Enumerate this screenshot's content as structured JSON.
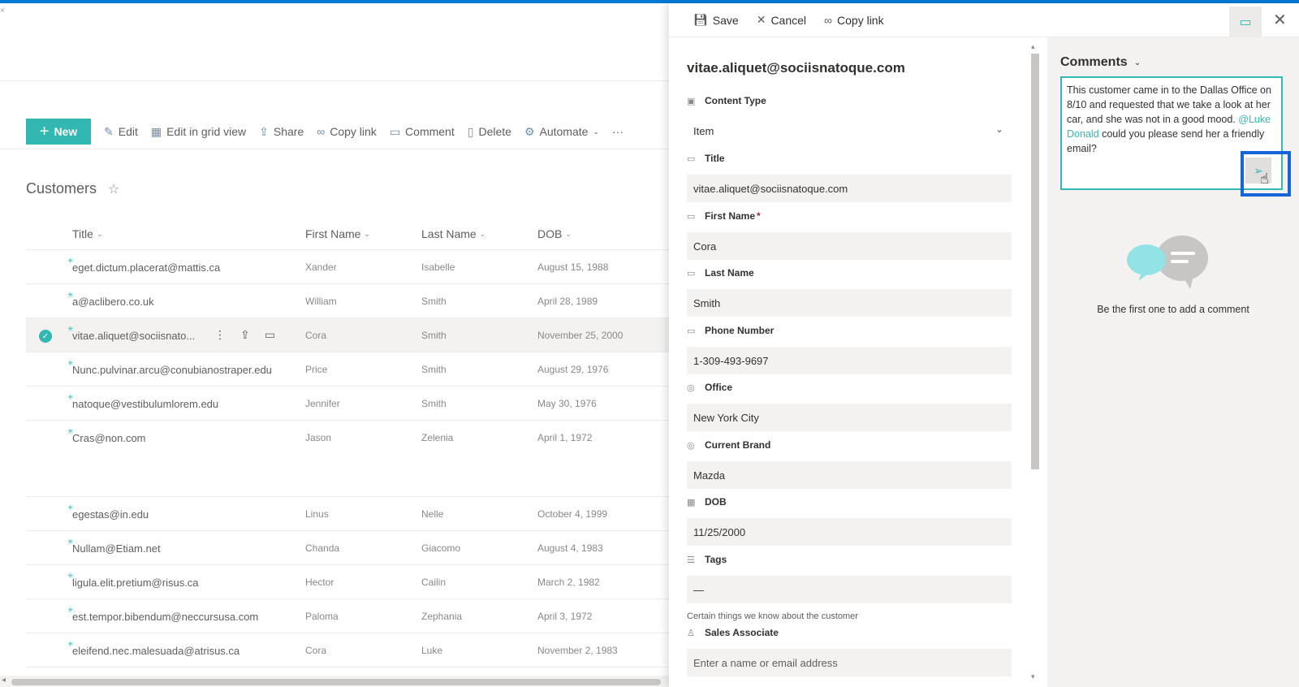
{
  "commandbar": {
    "new_label": "New",
    "edit_label": "Edit",
    "grid_label": "Edit in grid view",
    "share_label": "Share",
    "copylink_label": "Copy link",
    "comment_label": "Comment",
    "delete_label": "Delete",
    "automate_label": "Automate",
    "more_label": "···"
  },
  "list": {
    "title": "Customers",
    "columns": [
      "Title",
      "First Name",
      "Last Name",
      "DOB"
    ],
    "rows": [
      {
        "title": "eget.dictum.placerat@mattis.ca",
        "first": "Xander",
        "last": "Isabelle",
        "dob": "August 15, 1988"
      },
      {
        "title": "a@aclibero.co.uk",
        "first": "William",
        "last": "Smith",
        "dob": "April 28, 1989"
      },
      {
        "title": "vitae.aliquet@sociisnato...",
        "first": "Cora",
        "last": "Smith",
        "dob": "November 25, 2000",
        "selected": true
      },
      {
        "title": "Nunc.pulvinar.arcu@conubianostraper.edu",
        "first": "Price",
        "last": "Smith",
        "dob": "August 29, 1976"
      },
      {
        "title": "natoque@vestibulumlorem.edu",
        "first": "Jennifer",
        "last": "Smith",
        "dob": "May 30, 1976"
      },
      {
        "title": "Cras@non.com",
        "first": "Jason",
        "last": "Zelenia",
        "dob": "April 1, 1972"
      },
      {
        "title": "egestas@in.edu",
        "first": "Linus",
        "last": "Nelle",
        "dob": "October 4, 1999"
      },
      {
        "title": "Nullam@Etiam.net",
        "first": "Chanda",
        "last": "Giacomo",
        "dob": "August 4, 1983"
      },
      {
        "title": "ligula.elit.pretium@risus.ca",
        "first": "Hector",
        "last": "Cailin",
        "dob": "March 2, 1982"
      },
      {
        "title": "est.tempor.bibendum@neccursusa.com",
        "first": "Paloma",
        "last": "Zephania",
        "dob": "April 3, 1972"
      },
      {
        "title": "eleifend.nec.malesuada@atrisus.ca",
        "first": "Cora",
        "last": "Luke",
        "dob": "November 2, 1983"
      }
    ]
  },
  "panel": {
    "save_label": "Save",
    "cancel_label": "Cancel",
    "copylink_label": "Copy link",
    "item_title": "vitae.aliquet@sociisnatoque.com",
    "fields": [
      {
        "label": "Content Type",
        "value": "Item",
        "icon": "content-type-icon"
      },
      {
        "label": "Title",
        "value": "vitae.aliquet@sociisnatoque.com",
        "icon": "text-field-icon"
      },
      {
        "label": "First Name",
        "value": "Cora",
        "icon": "text-field-icon",
        "required": "*"
      },
      {
        "label": "Last Name",
        "value": "Smith",
        "icon": "text-field-icon"
      },
      {
        "label": "Phone Number",
        "value": "1-309-493-9697",
        "icon": "text-field-icon"
      },
      {
        "label": "Office",
        "value": "New York City",
        "icon": "choice-icon"
      },
      {
        "label": "Current Brand",
        "value": "Mazda",
        "icon": "choice-icon"
      },
      {
        "label": "DOB",
        "value": "11/25/2000",
        "icon": "calendar-icon"
      },
      {
        "label": "Tags",
        "value": "—",
        "icon": "list-icon",
        "description": "Certain things we know about the customer"
      },
      {
        "label": "Sales Associate",
        "placeholder": "Enter a name or email address",
        "icon": "person-icon"
      }
    ]
  },
  "comments": {
    "header": "Comments",
    "text_before": "This customer came in to the Dallas Office on 8/10 and requested that we take a look at her car, and she was not in a good mood. ",
    "mention": "@Luke Donald",
    "text_after": " could you please send her a friendly email?",
    "empty_text": "Be the first one to add a comment"
  },
  "colors": {
    "accent": "#33b7b2",
    "brand_bar": "#0078d4",
    "highlight_box": "#1565d8"
  }
}
